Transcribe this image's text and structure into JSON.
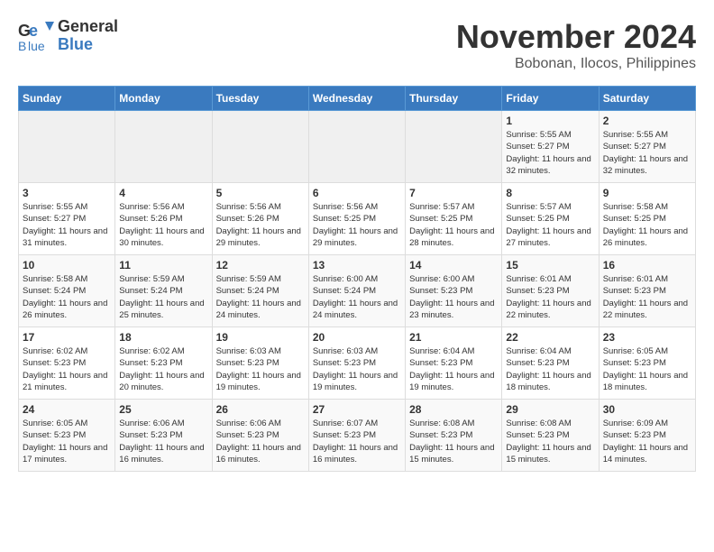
{
  "logo": {
    "line1": "General",
    "line2": "Blue"
  },
  "title": "November 2024",
  "location": "Bobonan, Ilocos, Philippines",
  "weekdays": [
    "Sunday",
    "Monday",
    "Tuesday",
    "Wednesday",
    "Thursday",
    "Friday",
    "Saturday"
  ],
  "weeks": [
    [
      {
        "day": "",
        "info": ""
      },
      {
        "day": "",
        "info": ""
      },
      {
        "day": "",
        "info": ""
      },
      {
        "day": "",
        "info": ""
      },
      {
        "day": "",
        "info": ""
      },
      {
        "day": "1",
        "info": "Sunrise: 5:55 AM\nSunset: 5:27 PM\nDaylight: 11 hours and 32 minutes."
      },
      {
        "day": "2",
        "info": "Sunrise: 5:55 AM\nSunset: 5:27 PM\nDaylight: 11 hours and 32 minutes."
      }
    ],
    [
      {
        "day": "3",
        "info": "Sunrise: 5:55 AM\nSunset: 5:27 PM\nDaylight: 11 hours and 31 minutes."
      },
      {
        "day": "4",
        "info": "Sunrise: 5:56 AM\nSunset: 5:26 PM\nDaylight: 11 hours and 30 minutes."
      },
      {
        "day": "5",
        "info": "Sunrise: 5:56 AM\nSunset: 5:26 PM\nDaylight: 11 hours and 29 minutes."
      },
      {
        "day": "6",
        "info": "Sunrise: 5:56 AM\nSunset: 5:25 PM\nDaylight: 11 hours and 29 minutes."
      },
      {
        "day": "7",
        "info": "Sunrise: 5:57 AM\nSunset: 5:25 PM\nDaylight: 11 hours and 28 minutes."
      },
      {
        "day": "8",
        "info": "Sunrise: 5:57 AM\nSunset: 5:25 PM\nDaylight: 11 hours and 27 minutes."
      },
      {
        "day": "9",
        "info": "Sunrise: 5:58 AM\nSunset: 5:25 PM\nDaylight: 11 hours and 26 minutes."
      }
    ],
    [
      {
        "day": "10",
        "info": "Sunrise: 5:58 AM\nSunset: 5:24 PM\nDaylight: 11 hours and 26 minutes."
      },
      {
        "day": "11",
        "info": "Sunrise: 5:59 AM\nSunset: 5:24 PM\nDaylight: 11 hours and 25 minutes."
      },
      {
        "day": "12",
        "info": "Sunrise: 5:59 AM\nSunset: 5:24 PM\nDaylight: 11 hours and 24 minutes."
      },
      {
        "day": "13",
        "info": "Sunrise: 6:00 AM\nSunset: 5:24 PM\nDaylight: 11 hours and 24 minutes."
      },
      {
        "day": "14",
        "info": "Sunrise: 6:00 AM\nSunset: 5:23 PM\nDaylight: 11 hours and 23 minutes."
      },
      {
        "day": "15",
        "info": "Sunrise: 6:01 AM\nSunset: 5:23 PM\nDaylight: 11 hours and 22 minutes."
      },
      {
        "day": "16",
        "info": "Sunrise: 6:01 AM\nSunset: 5:23 PM\nDaylight: 11 hours and 22 minutes."
      }
    ],
    [
      {
        "day": "17",
        "info": "Sunrise: 6:02 AM\nSunset: 5:23 PM\nDaylight: 11 hours and 21 minutes."
      },
      {
        "day": "18",
        "info": "Sunrise: 6:02 AM\nSunset: 5:23 PM\nDaylight: 11 hours and 20 minutes."
      },
      {
        "day": "19",
        "info": "Sunrise: 6:03 AM\nSunset: 5:23 PM\nDaylight: 11 hours and 19 minutes."
      },
      {
        "day": "20",
        "info": "Sunrise: 6:03 AM\nSunset: 5:23 PM\nDaylight: 11 hours and 19 minutes."
      },
      {
        "day": "21",
        "info": "Sunrise: 6:04 AM\nSunset: 5:23 PM\nDaylight: 11 hours and 19 minutes."
      },
      {
        "day": "22",
        "info": "Sunrise: 6:04 AM\nSunset: 5:23 PM\nDaylight: 11 hours and 18 minutes."
      },
      {
        "day": "23",
        "info": "Sunrise: 6:05 AM\nSunset: 5:23 PM\nDaylight: 11 hours and 18 minutes."
      }
    ],
    [
      {
        "day": "24",
        "info": "Sunrise: 6:05 AM\nSunset: 5:23 PM\nDaylight: 11 hours and 17 minutes."
      },
      {
        "day": "25",
        "info": "Sunrise: 6:06 AM\nSunset: 5:23 PM\nDaylight: 11 hours and 16 minutes."
      },
      {
        "day": "26",
        "info": "Sunrise: 6:06 AM\nSunset: 5:23 PM\nDaylight: 11 hours and 16 minutes."
      },
      {
        "day": "27",
        "info": "Sunrise: 6:07 AM\nSunset: 5:23 PM\nDaylight: 11 hours and 16 minutes."
      },
      {
        "day": "28",
        "info": "Sunrise: 6:08 AM\nSunset: 5:23 PM\nDaylight: 11 hours and 15 minutes."
      },
      {
        "day": "29",
        "info": "Sunrise: 6:08 AM\nSunset: 5:23 PM\nDaylight: 11 hours and 15 minutes."
      },
      {
        "day": "30",
        "info": "Sunrise: 6:09 AM\nSunset: 5:23 PM\nDaylight: 11 hours and 14 minutes."
      }
    ]
  ]
}
